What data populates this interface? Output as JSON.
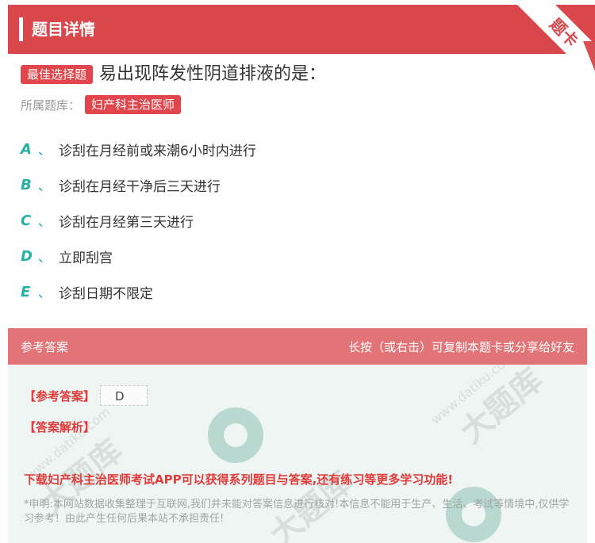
{
  "header": {
    "title": "题目详情",
    "ribbon": "题卡"
  },
  "question": {
    "type_tag": "最佳选择题",
    "text": "易出现阵发性阴道排液的是：",
    "bank_label": "所属题库：",
    "bank_name": "妇产科主治医师"
  },
  "options": [
    {
      "letter": "A",
      "sep": "、",
      "text": "诊刮在月经前或来潮6小时内进行"
    },
    {
      "letter": "B",
      "sep": "、",
      "text": "诊刮在月经干净后三天进行"
    },
    {
      "letter": "C",
      "sep": "、",
      "text": "诊刮在月经第三天进行"
    },
    {
      "letter": "D",
      "sep": "、",
      "text": "立即刮宫"
    },
    {
      "letter": "E",
      "sep": "、",
      "text": "诊刮日期不限定"
    }
  ],
  "answer_section": {
    "title": "参考答案",
    "hint": "长按（或右击）可复制本题卡或分享给好友",
    "ref_label": "【参考答案】",
    "ref_value": "D",
    "analysis_label": "【答案解析】",
    "promo": "下载妇产科主治医师考试APP可以获得系列题目与答案,还有练习等更多学习功能!",
    "disclaimer": "*申明:本网站数据收集整理于互联网,我们并未能对答案信息进行核对!本信息不能用于生产、生活、考试等情境中,仅供学习参考！由此产生任何后果本站不承担责任!"
  },
  "colors": {
    "brand_red": "#d9464b",
    "option_teal": "#26b0a6",
    "answer_bg": "#eef5f2"
  }
}
